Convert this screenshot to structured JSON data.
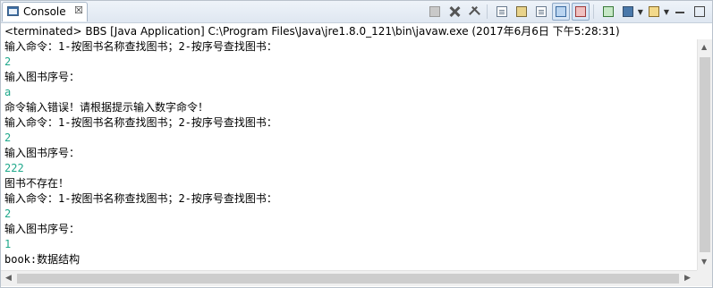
{
  "tab": {
    "label": "Console",
    "close": "☒"
  },
  "toolbar": {
    "buttons": [
      "terminate-icon",
      "remove-launch-icon",
      "remove-all-icon",
      "clear-console-icon",
      "scroll-lock-icon",
      "word-wrap-icon",
      "pin-console-icon",
      "display-selected-console-icon",
      "new-console-icon",
      "open-console-icon"
    ]
  },
  "status": "<terminated> BBS [Java Application] C:\\Program Files\\Java\\jre1.8.0_121\\bin\\javaw.exe (2017年6月6日 下午5:28:31)",
  "console_lines": [
    {
      "text": "输入命令：1-按图书名称查找图书；2-按序号查找图书：",
      "type": "output"
    },
    {
      "text": "2",
      "type": "input"
    },
    {
      "text": "输入图书序号：",
      "type": "output"
    },
    {
      "text": "a",
      "type": "input"
    },
    {
      "text": "命令输入错误！请根据提示输入数字命令！",
      "type": "output"
    },
    {
      "text": "输入命令：1-按图书名称查找图书；2-按序号查找图书：",
      "type": "output"
    },
    {
      "text": "2",
      "type": "input"
    },
    {
      "text": "输入图书序号：",
      "type": "output"
    },
    {
      "text": "222",
      "type": "input"
    },
    {
      "text": "图书不存在！",
      "type": "output"
    },
    {
      "text": "输入命令：1-按图书名称查找图书；2-按序号查找图书：",
      "type": "output"
    },
    {
      "text": "2",
      "type": "input"
    },
    {
      "text": "输入图书序号：",
      "type": "output"
    },
    {
      "text": "1",
      "type": "input"
    },
    {
      "text": "book:数据结构",
      "type": "output"
    }
  ],
  "colors": {
    "input_text": "#1fa88b",
    "output_text": "#000000"
  }
}
